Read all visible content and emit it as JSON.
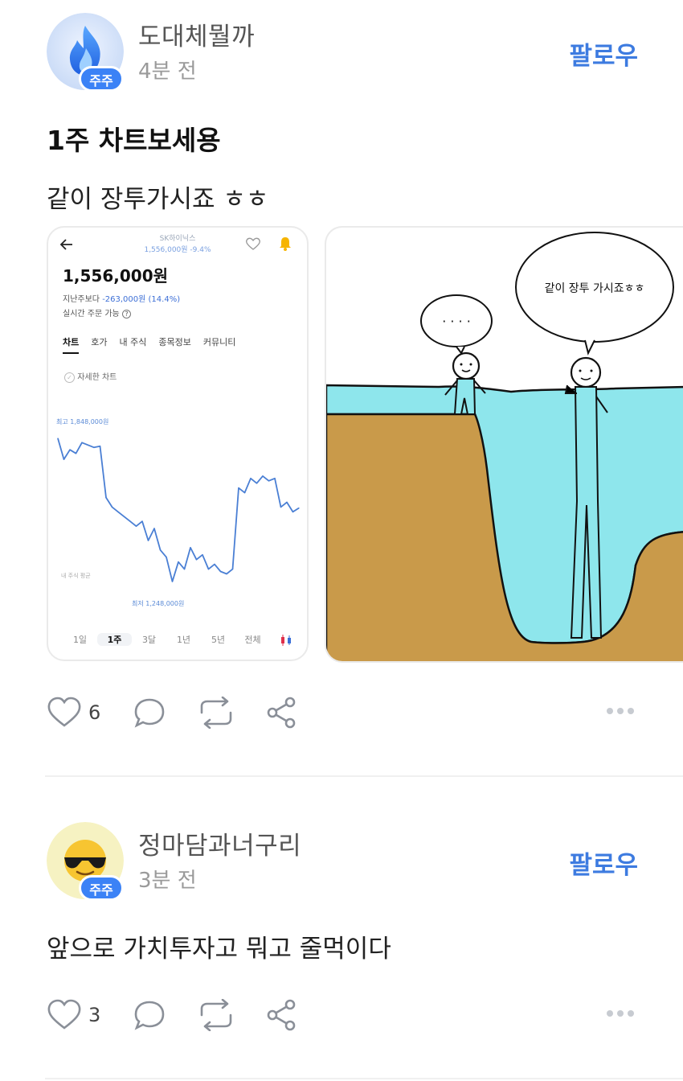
{
  "posts": [
    {
      "username": "도대체뭘까",
      "time": "4분 전",
      "badge": "주주",
      "follow_label": "팔로우",
      "title": "1주 차트보세용",
      "body": "같이 장투가시죠 ㅎㅎ",
      "likes": "6",
      "avatar_icon": "blue-flame-icon"
    },
    {
      "username": "정마담과너구리",
      "time": "3분 전",
      "badge": "주주",
      "follow_label": "팔로우",
      "body": "앞으로 가치투자고 뭐고 줄먹이다",
      "likes": "3",
      "avatar_icon": "sunglasses-emoji-icon"
    }
  ],
  "stock_card": {
    "name": "SK하이닉스",
    "sub": "1,556,000원 -9.4%",
    "price": "1,556,000원",
    "change_label": "지난주보다",
    "change_value": "-263,000원 (14.4%)",
    "realtime": "실시간 주문 가능",
    "tabs": [
      "차트",
      "호가",
      "내 주식",
      "종목정보",
      "커뮤니티"
    ],
    "detail_chart": "자세한 차트",
    "high_label": "최고 1,848,000원",
    "low_label": "최저 1,248,000원",
    "avg_label": "내 주식 평균",
    "periods": [
      "1일",
      "1주",
      "3달",
      "1년",
      "5년",
      "전체"
    ],
    "active_period": "1주",
    "line_color": "#4a7fd4"
  },
  "chart_data": {
    "type": "line",
    "title": "",
    "xlabel": "",
    "ylabel": "",
    "ylim": [
      1248000,
      1848000
    ],
    "series": [
      {
        "values": [
          1848000,
          1760000,
          1800000,
          1785000,
          1830000,
          1820000,
          1810000,
          1815000,
          1600000,
          1560000,
          1540000,
          1520000,
          1500000,
          1480000,
          1500000,
          1420000,
          1470000,
          1380000,
          1350000,
          1248000,
          1330000,
          1300000,
          1390000,
          1340000,
          1360000,
          1300000,
          1320000,
          1290000,
          1280000,
          1300000,
          1640000,
          1620000,
          1680000,
          1660000,
          1690000,
          1670000,
          1680000,
          1560000,
          1580000,
          1540000,
          1556000
        ]
      }
    ]
  },
  "meme_card": {
    "small_bubble": "· · · ·",
    "big_bubble": "같이 장투 가시죠ㅎㅎ"
  }
}
